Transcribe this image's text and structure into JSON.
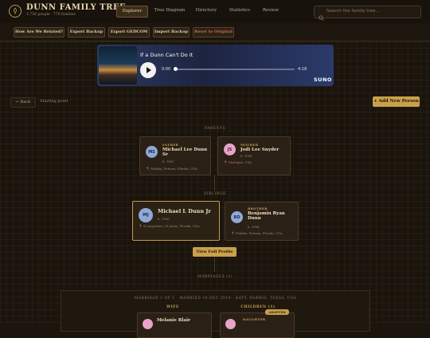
{
  "header": {
    "title": "DUNN FAMILY TREE",
    "subtitle": "1,756 people · 770 families",
    "nav": [
      "Explorer",
      "Tree Diagram",
      "Directory",
      "Statistics",
      "Review"
    ],
    "search_placeholder": "Search the family tree..."
  },
  "toolbar": {
    "buttons": [
      "How Are We Related?",
      "Export Backup",
      "Export GEDCOM",
      "Import Backup",
      "Reset to Original"
    ]
  },
  "player": {
    "title": "If a Dunn Can't Do It",
    "current_time": "0:00",
    "duration": "4:18",
    "brand": "SUNO",
    "progress": 0
  },
  "explorer": {
    "back_label": "← Back",
    "starting_point": "Starting point",
    "add_label": "+ Add New Person",
    "parents_label": "PARENTS",
    "siblings_label": "SIBLINGS",
    "view_profile": "View Full Profile",
    "marriages_label": "MARRIAGES (1)"
  },
  "father": {
    "role": "FATHER",
    "initials": "MS",
    "name": "Michael Lee Dunn Sr",
    "born": "b. 1963",
    "place": "Palatka, Putnam, Florida, USA"
  },
  "mother": {
    "role": "MOTHER",
    "initials": "JS",
    "name": "Jodi Lee Snyder",
    "born": "b. 1964",
    "place": "Michigan, USA"
  },
  "focus": {
    "initials": "MJ",
    "name": "Michael L Dunn Jr",
    "born": "b. 1986",
    "place": "St Augustine, St Johns, Florida, USA"
  },
  "brother": {
    "role": "BROTHER",
    "initials": "BD",
    "name": "Benjamin Ryan Dunn",
    "born": "b. 1984",
    "place": "Palatka, Putnam, Florida, USA"
  },
  "marriage": {
    "header": "MARRIAGE 1 OF 1 · MARRIED 18 DEC 2014 · KATY, HARRIS, TEXAS, USA",
    "wife_label": "WIFE",
    "wife_name": "Melanie Blair",
    "children_label": "CHILDREN (1)",
    "child_role": "DAUGHTER",
    "adopted": "ADOPTED"
  },
  "colors": {
    "accent": "#c9a04b",
    "background": "#1a140d",
    "male_avatar": "#8fa8d8",
    "female_avatar": "#e7a3c8"
  }
}
